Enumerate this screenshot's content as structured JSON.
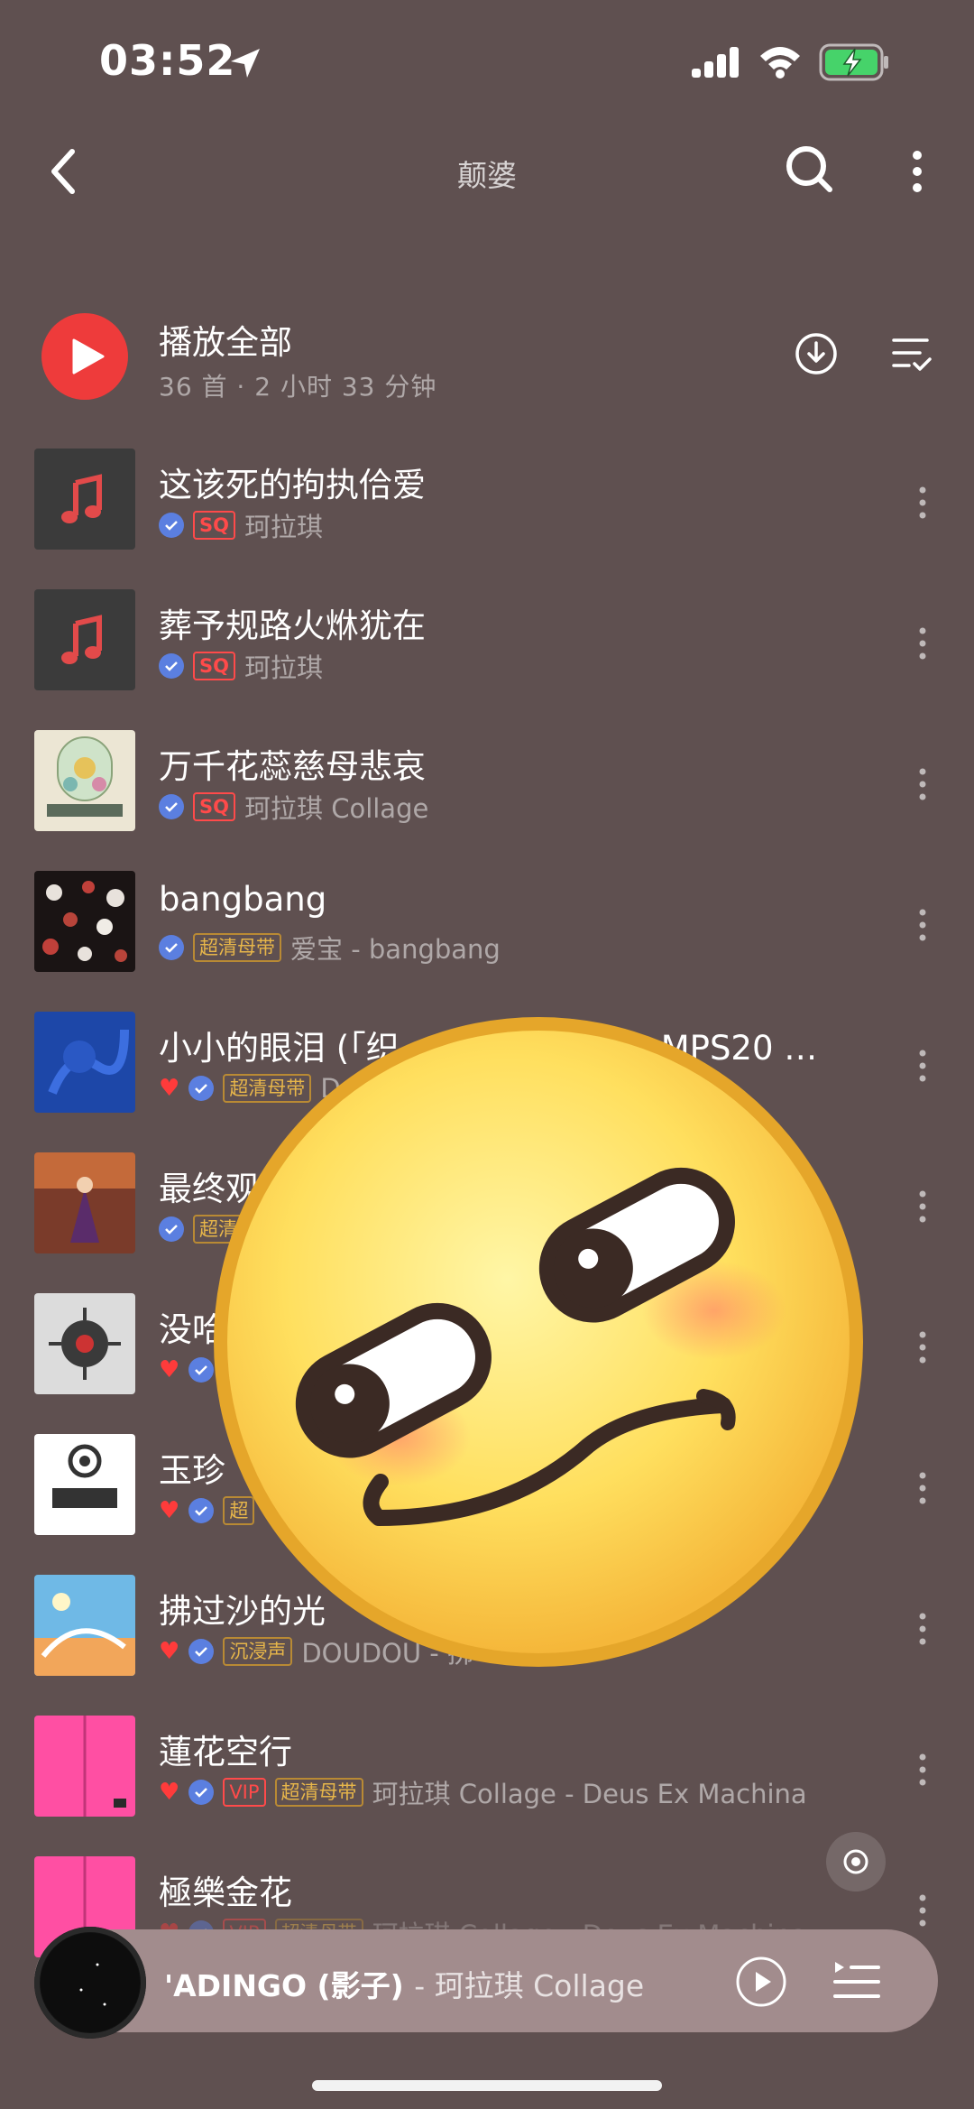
{
  "status_bar": {
    "time": "03:52"
  },
  "header": {
    "title": "颠婆"
  },
  "play_all": {
    "label": "播放全部",
    "summary": "36 首 · 2 小时 33 分钟"
  },
  "colors": {
    "accent": "#ee3b3b",
    "background": "#5f5050",
    "verified": "#5b7fe0",
    "tag_gold": "#e7b64a"
  },
  "songs": [
    {
      "title": "这该死的拘执佮爱",
      "liked": false,
      "tags": [
        "SQ"
      ],
      "artist": "珂拉琪"
    },
    {
      "title": "葬予规路火烌犹在",
      "liked": false,
      "tags": [
        "SQ"
      ],
      "artist": "珂拉琪"
    },
    {
      "title": "万千花蕊慈母悲哀",
      "liked": false,
      "tags": [
        "SQ"
      ],
      "artist": "珂拉琪 Collage"
    },
    {
      "title": "bangbang",
      "liked": false,
      "tags": [
        "超清母带"
      ],
      "artist": "爱宝 - bangbang"
    },
    {
      "title": "小小的眼泪 (「织",
      "title_tail": "MPS20 周…",
      "liked": true,
      "tags": [
        "超清母带"
      ],
      "artist": "D"
    },
    {
      "title": "最终观",
      "liked": false,
      "tags": [
        "超清"
      ],
      "artist": ""
    },
    {
      "title": "没哈",
      "liked": true,
      "tags": [],
      "artist": ""
    },
    {
      "title": "玉珍",
      "liked": true,
      "tags": [
        "超"
      ],
      "artist": ""
    },
    {
      "title": "拂过沙的光",
      "liked": true,
      "tags": [
        "沉浸声"
      ],
      "artist": "DOUDOU - 拂"
    },
    {
      "title": "蓮花空行",
      "liked": true,
      "tags": [
        "VIP",
        "超清母带"
      ],
      "artist": "珂拉琪 Collage - Deus Ex Machina"
    },
    {
      "title": "極樂金花",
      "liked": true,
      "tags": [
        "VIP",
        "超清母带"
      ],
      "artist": "珂拉琪 Collage - Deus Ex Machina"
    }
  ],
  "now_playing": {
    "title": "'ADINGO (影子)",
    "artist": "- 珂拉琪 Collage"
  },
  "icons": [
    "location-arrow-icon",
    "signal-icon",
    "wifi-icon",
    "battery-charging-icon",
    "back-icon",
    "search-icon",
    "more-icon",
    "play-icon",
    "download-icon",
    "multiselect-icon",
    "heart-icon",
    "verified-icon",
    "locate-icon",
    "queue-icon",
    "emoji-sticker"
  ]
}
